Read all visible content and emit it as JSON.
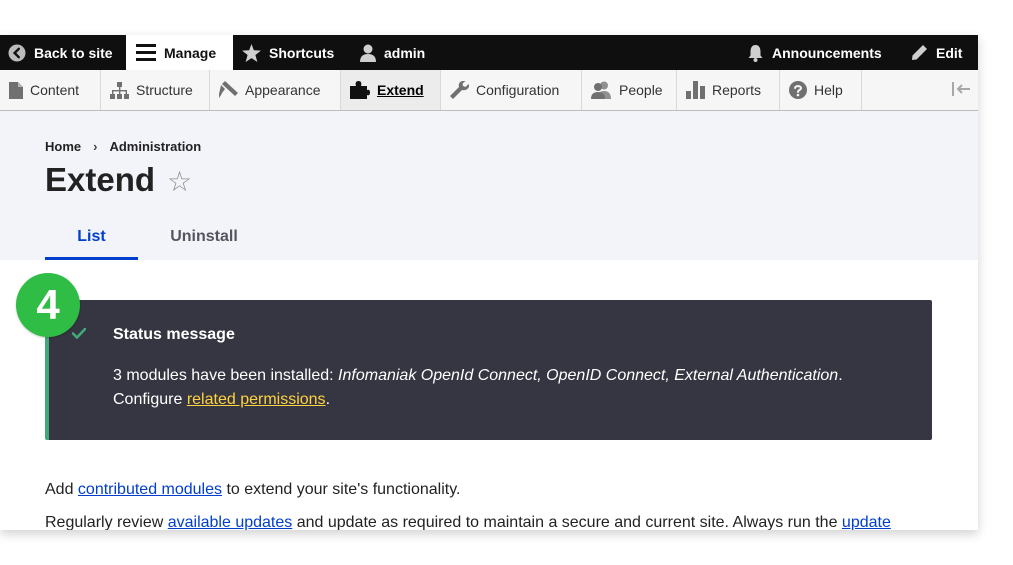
{
  "toolbar": {
    "back_to_site": "Back to site",
    "manage": "Manage",
    "shortcuts": "Shortcuts",
    "user": "admin",
    "announcements": "Announcements",
    "edit": "Edit"
  },
  "tray": {
    "items": [
      {
        "label": "Content",
        "icon": "file-icon"
      },
      {
        "label": "Structure",
        "icon": "sitemap-icon"
      },
      {
        "label": "Appearance",
        "icon": "brush-icon"
      },
      {
        "label": "Extend",
        "icon": "puzzle-icon",
        "active": true
      },
      {
        "label": "Configuration",
        "icon": "wrench-icon"
      },
      {
        "label": "People",
        "icon": "people-icon"
      },
      {
        "label": "Reports",
        "icon": "bar-chart-icon"
      },
      {
        "label": "Help",
        "icon": "help-icon"
      }
    ]
  },
  "breadcrumb": {
    "home": "Home",
    "separator": "›",
    "administration": "Administration"
  },
  "page": {
    "title": "Extend",
    "star": "☆"
  },
  "tabs": {
    "list": "List",
    "uninstall": "Uninstall"
  },
  "step_badge": "4",
  "status": {
    "title": "Status message",
    "line1_prefix": "3 modules have been installed: ",
    "line1_modules": "Infomaniak OpenId Connect, OpenID Connect, External Authentication",
    "line1_suffix": ".",
    "line2_prefix": "Configure ",
    "line2_link": "related permissions",
    "line2_suffix": "."
  },
  "content": {
    "p1_prefix": "Add ",
    "p1_link": "contributed modules",
    "p1_suffix": " to extend your site's functionality.",
    "p2_prefix": "Regularly review ",
    "p2_link1": "available updates",
    "p2_middle": " and update as required to maintain a secure and current site. Always run the ",
    "p2_link2": "update"
  },
  "colors": {
    "toolbar_bg": "#0f0f0f",
    "accent_blue": "#003ecc",
    "status_bg": "#353641",
    "status_border": "#42a877",
    "link_yellow": "#ffd23f",
    "badge_green": "#2fbd45"
  }
}
